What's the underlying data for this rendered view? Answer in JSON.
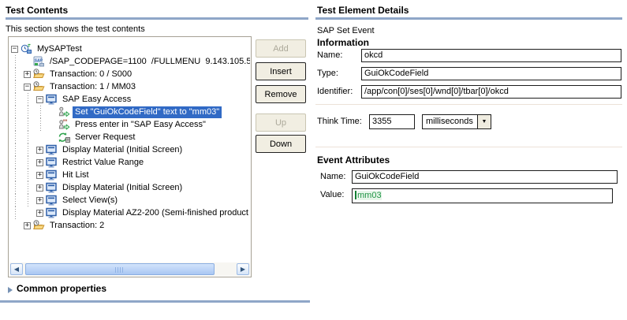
{
  "left_panel": {
    "title": "Test Contents",
    "subtitle": "This section shows the test contents",
    "tree": [
      {
        "level": 0,
        "expander": "-",
        "icon": "sap-test-icon",
        "label": "MySAPTest",
        "selected": false
      },
      {
        "level": 1,
        "expander": "",
        "icon": "sap-connection-icon",
        "label": "/SAP_CODEPAGE=1100  /FULLMENU  9.143.105.5",
        "selected": false
      },
      {
        "level": 1,
        "expander": "+",
        "icon": "transaction-icon",
        "label": "Transaction: 0 / S000",
        "selected": false
      },
      {
        "level": 1,
        "expander": "-",
        "icon": "transaction-icon",
        "label": "Transaction: 1 / MM03",
        "selected": false
      },
      {
        "level": 2,
        "expander": "-",
        "icon": "sap-screen-icon",
        "label": "SAP Easy Access",
        "selected": false
      },
      {
        "level": 3,
        "expander": "",
        "icon": "set-text-icon",
        "label": "Set \"GuiOkCodeField\" text to \"mm03\"",
        "selected": true
      },
      {
        "level": 3,
        "expander": "",
        "icon": "press-enter-icon",
        "label": "Press enter in \"SAP Easy Access\"",
        "selected": false
      },
      {
        "level": 3,
        "expander": "",
        "icon": "server-request-icon",
        "label": "Server Request",
        "selected": false
      },
      {
        "level": 2,
        "expander": "+",
        "icon": "sap-screen-icon",
        "label": "Display Material (Initial Screen)",
        "selected": false
      },
      {
        "level": 2,
        "expander": "+",
        "icon": "sap-screen-icon",
        "label": "Restrict Value Range",
        "selected": false
      },
      {
        "level": 2,
        "expander": "+",
        "icon": "sap-screen-icon",
        "label": "Hit List",
        "selected": false
      },
      {
        "level": 2,
        "expander": "+",
        "icon": "sap-screen-icon",
        "label": "Display Material (Initial Screen)",
        "selected": false
      },
      {
        "level": 2,
        "expander": "+",
        "icon": "sap-screen-icon",
        "label": "Select View(s)",
        "selected": false
      },
      {
        "level": 2,
        "expander": "+",
        "icon": "sap-screen-icon",
        "label": "Display Material AZ2-200 (Semi-finished product",
        "selected": false
      },
      {
        "level": 1,
        "expander": "+",
        "icon": "transaction-icon",
        "label": "Transaction: 2",
        "selected": false
      }
    ],
    "buttons": [
      {
        "label": "Add",
        "enabled": false
      },
      {
        "label": "Insert",
        "enabled": true
      },
      {
        "label": "Remove",
        "enabled": true
      },
      {
        "label": "Up",
        "enabled": false
      },
      {
        "label": "Down",
        "enabled": true
      }
    ],
    "common_properties_label": "Common properties"
  },
  "right_panel": {
    "title": "Test Element Details",
    "element_type": "SAP Set Event",
    "information": {
      "heading": "Information",
      "rows": [
        {
          "label": "Name:",
          "value": "okcd"
        },
        {
          "label": "Type:",
          "value": "GuiOkCodeField"
        },
        {
          "label": "Identifier:",
          "value": "/app/con[0]/ses[0]/wnd[0]/tbar[0]/okcd"
        }
      ],
      "think_time_label": "Think Time:",
      "think_time_value": "3355",
      "think_time_unit": "milliseconds"
    },
    "event_attributes": {
      "heading": "Event Attributes",
      "name_label": "Name:",
      "name_value": "GuiOkCodeField",
      "value_label": "Value:",
      "value_value": "mm03"
    }
  },
  "colors": {
    "selection_bg": "#316ac5",
    "header_rule": "#8fa6c8",
    "value_text_green": "#1f9444",
    "value_highlight_bg": "#e7f6ea",
    "button_face": "#f1eee2"
  }
}
